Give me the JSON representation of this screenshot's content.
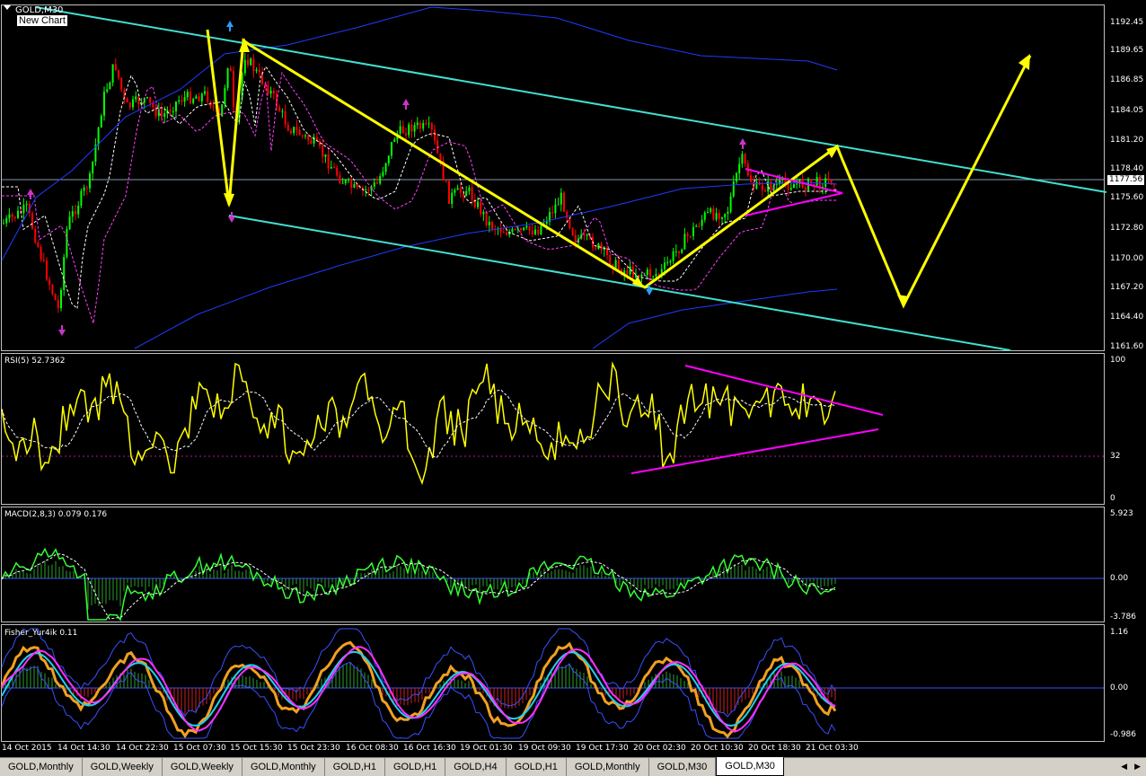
{
  "chart": {
    "symbol_label": "GOLD,M30",
    "chart_tag": "New Chart",
    "current_price": "1177.56",
    "price_ticks": [
      "1192.45",
      "1189.65",
      "1186.85",
      "1184.05",
      "1181.20",
      "1178.40",
      "1175.60",
      "1172.80",
      "1170.00",
      "1167.20",
      "1164.40",
      "1161.60"
    ],
    "time_ticks": [
      "14 Oct 2015",
      "14 Oct 14:30",
      "14 Oct 22:30",
      "15 Oct 07:30",
      "15 Oct 15:30",
      "15 Oct 23:30",
      "16 Oct 08:30",
      "16 Oct 16:30",
      "19 Oct 01:30",
      "19 Oct 09:30",
      "19 Oct 17:30",
      "20 Oct 02:30",
      "20 Oct 10:30",
      "20 Oct 18:30",
      "21 Oct 03:30"
    ],
    "colors": {
      "background": "#000000",
      "bull_candle": "#00ff00",
      "bear_candle": "#ff0000",
      "trend_channel": "#40e0d0",
      "bollinger": "#1e3cff",
      "projection": "#ffff00",
      "triangle": "#ff00ff"
    }
  },
  "indicators": {
    "rsi": {
      "label": "RSI(5) 52.7362",
      "levels": [
        "100",
        "32",
        "0"
      ]
    },
    "macd": {
      "label": "MACD(2,8,3) 0.079 0.176",
      "levels": [
        "5.923",
        "0.00",
        "-3.786"
      ]
    },
    "fisher": {
      "label": "Fisher_Yur4ik 0.11",
      "levels": [
        "1.16",
        "0.00",
        "-0.986"
      ]
    }
  },
  "tabs": [
    {
      "label": "GOLD,Monthly"
    },
    {
      "label": "GOLD,Weekly"
    },
    {
      "label": "GOLD,Weekly"
    },
    {
      "label": "GOLD,Monthly"
    },
    {
      "label": "GOLD,H1"
    },
    {
      "label": "GOLD,H1"
    },
    {
      "label": "GOLD,H4"
    },
    {
      "label": "GOLD,H1"
    },
    {
      "label": "GOLD,Monthly"
    },
    {
      "label": "GOLD,M30"
    },
    {
      "label": "GOLD,M30",
      "active": true
    }
  ],
  "tab_scroll": {
    "left_icon": "scroll-left-icon",
    "right_icon": "scroll-right-icon"
  }
}
